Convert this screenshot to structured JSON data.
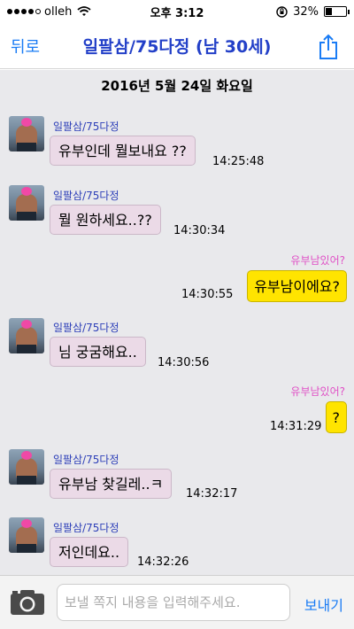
{
  "status": {
    "carrier": "olleh",
    "time": "오후 3:12",
    "battery": "32%",
    "battery_level": 0.32
  },
  "nav": {
    "back": "뒤로",
    "title": "일팔삼/75다정 (남 30세)",
    "accent": "#1a7cf5"
  },
  "chat": {
    "date": "2016년 5월 24일 화요일",
    "messages": [
      {
        "dir": "in",
        "sender": "일팔삼/75다정",
        "text": "유부인데 뭘보내요 ??",
        "time": "14:25:48"
      },
      {
        "dir": "in",
        "sender": "일팔삼/75다정",
        "text": "뭘 원하세요..??",
        "time": "14:30:34"
      },
      {
        "dir": "out",
        "label": "유부남있어?",
        "text": "유부남이에요?",
        "time": "14:30:55"
      },
      {
        "dir": "in",
        "sender": "일팔삼/75다정",
        "text": "님 궁굼해요..",
        "time": "14:30:56"
      },
      {
        "dir": "out",
        "label": "유부남있어?",
        "text": "?",
        "time": "14:31:29"
      },
      {
        "dir": "in",
        "sender": "일팔삼/75다정",
        "text": "유부남 찾길레..ㅋ",
        "time": "14:32:17"
      },
      {
        "dir": "in",
        "sender": "일팔삼/75다정",
        "text": "저인데요..",
        "time": "14:32:26"
      }
    ]
  },
  "input": {
    "placeholder": "보낼 쪽지 내용을 입력해주세요.",
    "send": "보내기"
  },
  "icons": {
    "wifi": "wifi-icon",
    "lock": "rotation-lock-icon",
    "share": "share-icon",
    "camera": "camera-icon"
  }
}
